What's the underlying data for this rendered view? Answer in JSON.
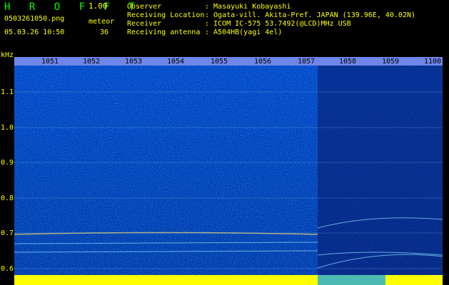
{
  "header": {
    "title": "H R O F F T",
    "version": "1.00",
    "filename": "0503261050.png",
    "meteor_label": "meteor",
    "datetime": "05.03.26 10:50",
    "meteor_count": "36"
  },
  "info": [
    {
      "key": "Observer",
      "value": ": Masayuki Kobayashi"
    },
    {
      "key": "Receiving Location",
      "value": ": Ogata-vill. Akita-Pref. JAPAN (139.96E, 40.02N)"
    },
    {
      "key": "Receiver",
      "value": ": ICOM IC-575 53.7492(@LCD)MHz USB"
    },
    {
      "key": "Receiving antenna",
      "value": ": A504HB(yagi 4el)"
    }
  ],
  "axes": {
    "y_unit": "kHz",
    "y_ticks": [
      "1.1",
      "1.0",
      "0.9",
      "0.8",
      "0.7",
      "0.6"
    ],
    "x_ticks": [
      "1051",
      "1052",
      "1053",
      "1054",
      "1055",
      "1056",
      "1057",
      "1058",
      "1059",
      "1100"
    ]
  },
  "colors": {
    "background": "#000000",
    "text_yellow": "#ffff00",
    "text_green": "#00ff00",
    "spectrogram_base": "#0a2aa8"
  }
}
